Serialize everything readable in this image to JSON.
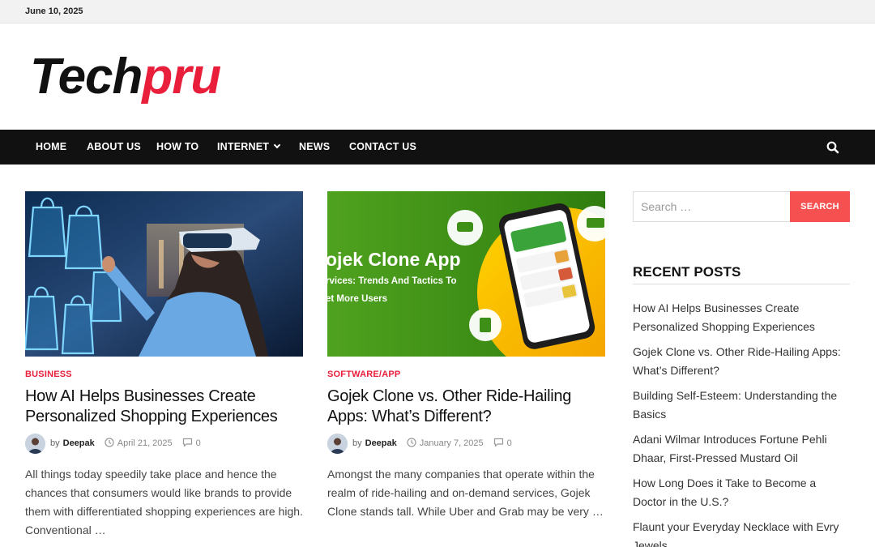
{
  "topbar": {
    "date": "June 10, 2025"
  },
  "site": {
    "logo_part1": "Tech",
    "logo_part2": "pru",
    "brand_color": "#e81e3a"
  },
  "nav": {
    "items": [
      {
        "label": "HOME"
      },
      {
        "label": "ABOUT US"
      },
      {
        "label": "HOW TO"
      },
      {
        "label": "INTERNET"
      },
      {
        "label": "NEWS"
      },
      {
        "label": "CONTACT US"
      }
    ],
    "search_icon": "search-icon"
  },
  "posts": [
    {
      "category": "BUSINESS",
      "title": "How AI Helps Businesses Create Personalized Shopping Experiences",
      "by": "by",
      "author": "Deepak",
      "date": "April 21, 2025",
      "comments": "0",
      "excerpt": "All things today speedily take place and hence the chances that consumers would like brands to provide them with differentiated shopping experiences are high. Conventional …"
    },
    {
      "category": "SOFTWARE/APP",
      "title": "Gojek Clone vs. Other Ride-Hailing Apps: What’s Different?",
      "by": "by",
      "author": "Deepak",
      "date": "January 7, 2025",
      "comments": "0",
      "excerpt": "Amongst the many companies that operate within the realm of ride-hailing and on-demand services, Gojek Clone stands tall. While Uber and Grab may be very …",
      "image_text": {
        "heading": "ojek Clone App",
        "line1": "rvices:  Trends And Tactics To",
        "line2": "et More Users"
      }
    }
  ],
  "sidebar": {
    "search_placeholder": "Search …",
    "search_button": "SEARCH",
    "recent_title": "RECENT POSTS",
    "recent_posts": [
      "How AI Helps Businesses Create Personalized Shopping Experiences",
      "Gojek Clone vs. Other Ride-Hailing Apps: What’s Different?",
      "Building Self-Esteem: Understanding the Basics",
      "Adani Wilmar Introduces Fortune Pehli Dhaar, First-Pressed Mustard Oil",
      "How Long Does it Take to Become a Doctor in the U.S.?",
      "Flaunt your Everyday Necklace with Evry Jewels"
    ]
  },
  "colors": {
    "nav_bg": "#111111",
    "search_button_bg": "#f75050",
    "category": "#e81e3a"
  }
}
